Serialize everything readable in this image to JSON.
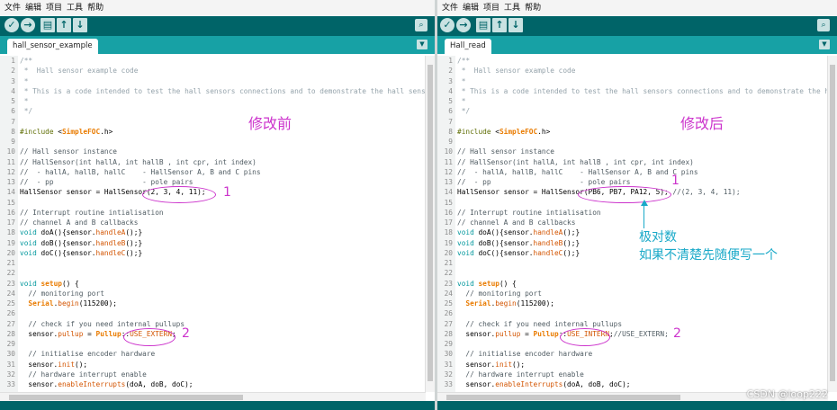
{
  "menu": [
    "文件",
    "编辑",
    "项目",
    "工具",
    "帮助"
  ],
  "toolbar_icons": [
    "verify-icon",
    "upload-icon",
    "new-icon",
    "open-icon",
    "save-icon",
    "serial-monitor-icon"
  ],
  "left": {
    "tab": "hall_sensor_example",
    "title": "修改前",
    "lines": [
      [
        {
          "c": "cm",
          "t": "/**"
        }
      ],
      [
        {
          "c": "cm",
          "t": " *  Hall sensor example code"
        }
      ],
      [
        {
          "c": "cm",
          "t": " *"
        }
      ],
      [
        {
          "c": "cm",
          "t": " * This is a code intended to test the hall sensors connections and to demonstrate the hall senso"
        }
      ],
      [
        {
          "c": "cm",
          "t": " *"
        }
      ],
      [
        {
          "c": "cm",
          "t": " */"
        }
      ],
      [],
      [
        {
          "c": "pre",
          "t": "#include "
        },
        {
          "c": "plain",
          "t": "<"
        },
        {
          "c": "lib",
          "t": "SimpleFOC"
        },
        {
          "c": "plain",
          "t": ".h>"
        }
      ],
      [],
      [
        {
          "c": "cm2",
          "t": "// Hall sensor instance"
        }
      ],
      [
        {
          "c": "cm2",
          "t": "// HallSensor(int hallA, int hallB , int cpr, int index)"
        }
      ],
      [
        {
          "c": "cm2",
          "t": "//  - hallA, hallB, hallC    - HallSensor A, B and C pins"
        }
      ],
      [
        {
          "c": "cm2",
          "t": "//  - pp                     - pole pairs"
        }
      ],
      [
        {
          "c": "plain",
          "t": "HallSensor sensor = HallSensor(2, 3, 4, 11);"
        }
      ],
      [],
      [
        {
          "c": "cm2",
          "t": "// Interrupt routine intialisation"
        }
      ],
      [
        {
          "c": "cm2",
          "t": "// channel A and B callbacks"
        }
      ],
      [
        {
          "c": "kw",
          "t": "void"
        },
        {
          "c": "plain",
          "t": " doA(){sensor."
        },
        {
          "c": "fn",
          "t": "handleA"
        },
        {
          "c": "plain",
          "t": "();}"
        }
      ],
      [
        {
          "c": "kw",
          "t": "void"
        },
        {
          "c": "plain",
          "t": " doB(){sensor."
        },
        {
          "c": "fn",
          "t": "handleB"
        },
        {
          "c": "plain",
          "t": "();}"
        }
      ],
      [
        {
          "c": "kw",
          "t": "void"
        },
        {
          "c": "plain",
          "t": " doC(){sensor."
        },
        {
          "c": "fn",
          "t": "handleC"
        },
        {
          "c": "plain",
          "t": "();}"
        }
      ],
      [],
      [],
      [
        {
          "c": "kw",
          "t": "void"
        },
        {
          "c": "plain",
          "t": " "
        },
        {
          "c": "lib",
          "t": "setup"
        },
        {
          "c": "plain",
          "t": "() {"
        }
      ],
      [
        {
          "c": "cm2",
          "t": "  // monitoring port"
        }
      ],
      [
        {
          "c": "plain",
          "t": "  "
        },
        {
          "c": "lib",
          "t": "Serial"
        },
        {
          "c": "plain",
          "t": "."
        },
        {
          "c": "fn",
          "t": "begin"
        },
        {
          "c": "plain",
          "t": "(115200);"
        }
      ],
      [],
      [
        {
          "c": "cm2",
          "t": "  // check if you need internal pullups"
        }
      ],
      [
        {
          "c": "plain",
          "t": "  sensor."
        },
        {
          "c": "fn",
          "t": "pullup"
        },
        {
          "c": "plain",
          "t": " = "
        },
        {
          "c": "lib",
          "t": "Pullup"
        },
        {
          "c": "plain",
          "t": "::"
        },
        {
          "c": "fn",
          "t": "USE_EXTERN"
        },
        {
          "c": "plain",
          "t": ";"
        }
      ],
      [],
      [
        {
          "c": "cm2",
          "t": "  // initialise encoder hardware"
        }
      ],
      [
        {
          "c": "plain",
          "t": "  sensor."
        },
        {
          "c": "fn",
          "t": "init"
        },
        {
          "c": "plain",
          "t": "();"
        }
      ],
      [
        {
          "c": "cm2",
          "t": "  // hardware interrupt enable"
        }
      ],
      [
        {
          "c": "plain",
          "t": "  sensor."
        },
        {
          "c": "fn",
          "t": "enableInterrupts"
        },
        {
          "c": "plain",
          "t": "(doA, doB, doC);"
        }
      ]
    ]
  },
  "right": {
    "tab": "Hall_read",
    "title": "修改后",
    "lines": [
      [
        {
          "c": "cm",
          "t": "/**"
        }
      ],
      [
        {
          "c": "cm",
          "t": " *  Hall sensor example code"
        }
      ],
      [
        {
          "c": "cm",
          "t": " *"
        }
      ],
      [
        {
          "c": "cm",
          "t": " * This is a code intended to test the hall sensors connections and to demonstrate the ha"
        }
      ],
      [
        {
          "c": "cm",
          "t": " *"
        }
      ],
      [
        {
          "c": "cm",
          "t": " */"
        }
      ],
      [],
      [
        {
          "c": "pre",
          "t": "#include "
        },
        {
          "c": "plain",
          "t": "<"
        },
        {
          "c": "lib",
          "t": "SimpleFOC"
        },
        {
          "c": "plain",
          "t": ".h>"
        }
      ],
      [],
      [
        {
          "c": "cm2",
          "t": "// Hall sensor instance"
        }
      ],
      [
        {
          "c": "cm2",
          "t": "// HallSensor(int hallA, int hallB , int cpr, int index)"
        }
      ],
      [
        {
          "c": "cm2",
          "t": "//  - hallA, hallB, hallC    - HallSensor A, B and C pins"
        }
      ],
      [
        {
          "c": "cm2",
          "t": "//  - pp                     - pole pairs"
        }
      ],
      [
        {
          "c": "plain",
          "t": "HallSensor sensor = HallSensor(PB6, PB7, PA12, 5); "
        },
        {
          "c": "cm2",
          "t": "//(2, 3, 4, 11);"
        }
      ],
      [],
      [
        {
          "c": "cm2",
          "t": "// Interrupt routine intialisation"
        }
      ],
      [
        {
          "c": "cm2",
          "t": "// channel A and B callbacks"
        }
      ],
      [
        {
          "c": "kw",
          "t": "void"
        },
        {
          "c": "plain",
          "t": " doA(){sensor."
        },
        {
          "c": "fn",
          "t": "handleA"
        },
        {
          "c": "plain",
          "t": "();}"
        }
      ],
      [
        {
          "c": "kw",
          "t": "void"
        },
        {
          "c": "plain",
          "t": " doB(){sensor."
        },
        {
          "c": "fn",
          "t": "handleB"
        },
        {
          "c": "plain",
          "t": "();}"
        }
      ],
      [
        {
          "c": "kw",
          "t": "void"
        },
        {
          "c": "plain",
          "t": " doC(){sensor."
        },
        {
          "c": "fn",
          "t": "handleC"
        },
        {
          "c": "plain",
          "t": "();}"
        }
      ],
      [],
      [],
      [
        {
          "c": "kw",
          "t": "void"
        },
        {
          "c": "plain",
          "t": " "
        },
        {
          "c": "lib",
          "t": "setup"
        },
        {
          "c": "plain",
          "t": "() {"
        }
      ],
      [
        {
          "c": "cm2",
          "t": "  // monitoring port"
        }
      ],
      [
        {
          "c": "plain",
          "t": "  "
        },
        {
          "c": "lib",
          "t": "Serial"
        },
        {
          "c": "plain",
          "t": "."
        },
        {
          "c": "fn",
          "t": "begin"
        },
        {
          "c": "plain",
          "t": "(115200);"
        }
      ],
      [],
      [
        {
          "c": "cm2",
          "t": "  // check if you need internal pullups"
        }
      ],
      [
        {
          "c": "plain",
          "t": "  sensor."
        },
        {
          "c": "fn",
          "t": "pullup"
        },
        {
          "c": "plain",
          "t": " = "
        },
        {
          "c": "lib",
          "t": "Pullup"
        },
        {
          "c": "plain",
          "t": "::"
        },
        {
          "c": "fn",
          "t": "USE_INTERN"
        },
        {
          "c": "plain",
          "t": ";"
        },
        {
          "c": "cm2",
          "t": "//USE_EXTERN;"
        }
      ],
      [],
      [
        {
          "c": "cm2",
          "t": "  // initialise encoder hardware"
        }
      ],
      [
        {
          "c": "plain",
          "t": "  sensor."
        },
        {
          "c": "fn",
          "t": "init"
        },
        {
          "c": "plain",
          "t": "();"
        }
      ],
      [
        {
          "c": "cm2",
          "t": "  // hardware interrupt enable"
        }
      ],
      [
        {
          "c": "plain",
          "t": "  sensor."
        },
        {
          "c": "fn",
          "t": "enableInterrupts"
        },
        {
          "c": "plain",
          "t": "(doA, doB, doC);"
        }
      ]
    ]
  },
  "annotations": {
    "num1": "1",
    "num2": "2",
    "note_line1": "极对数",
    "note_line2": "如果不清楚先随便写一个"
  },
  "watermark": "CSDN @loop222",
  "colors": {
    "toolbar": "#006468",
    "tabbar": "#17a1a5",
    "annotation_magenta": "#cc33cc",
    "annotation_cyan": "#19a9c8"
  }
}
